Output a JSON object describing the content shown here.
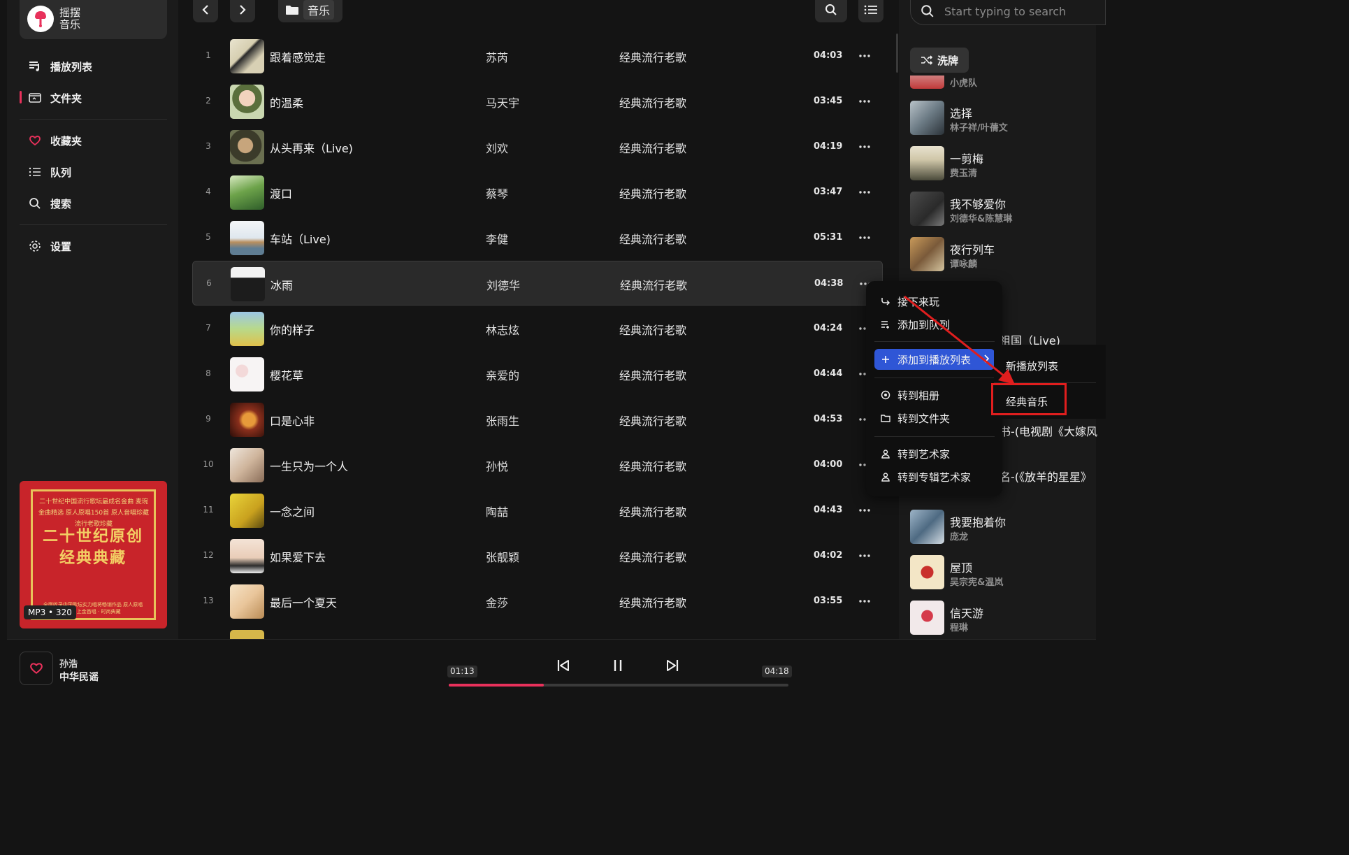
{
  "app": {
    "name": "摇摆音乐"
  },
  "sidebar": {
    "items": [
      {
        "label": "播放列表",
        "icon": "playlist-icon"
      },
      {
        "label": "文件夹",
        "icon": "folder-icon",
        "active": true
      },
      {
        "label": "收藏夹",
        "icon": "heart-icon"
      },
      {
        "label": "队列",
        "icon": "queue-icon"
      },
      {
        "label": "搜索",
        "icon": "search-icon"
      },
      {
        "label": "设置",
        "icon": "gear-icon"
      }
    ],
    "accent_color": "#e8315b",
    "cover": {
      "top_text": "二十世纪中国流行歌坛最成名金曲 麦琬金曲精选 原人原唱150首 原人音唱珍藏 流行老歌珍藏",
      "big_text": "二十世纪原创经典典藏",
      "bottom_text": "全面收录中国歌坛实力唱将畅销作品 原人原唱 百首 上金首唱 · 时尚典藏"
    },
    "quality": "MP3 • 320"
  },
  "topbar": {
    "back": "chevron-left-icon",
    "forward": "chevron-right-icon",
    "breadcrumb_folder": "音乐"
  },
  "songs": [
    {
      "index": "1",
      "title": "跟着感觉走",
      "artist": "苏芮",
      "album": "经典流行老歌",
      "duration": "04:03"
    },
    {
      "index": "2",
      "title": "的温柔",
      "artist": "马天宇",
      "album": "经典流行老歌",
      "duration": "03:45"
    },
    {
      "index": "3",
      "title": "从头再来（Live)",
      "artist": "刘欢",
      "album": "经典流行老歌",
      "duration": "04:19"
    },
    {
      "index": "4",
      "title": "渡口",
      "artist": "蔡琴",
      "album": "经典流行老歌",
      "duration": "03:47"
    },
    {
      "index": "5",
      "title": "车站（Live)",
      "artist": "李健",
      "album": "经典流行老歌",
      "duration": "05:31"
    },
    {
      "index": "6",
      "title": "冰雨",
      "artist": "刘德华",
      "album": "经典流行老歌",
      "duration": "04:38"
    },
    {
      "index": "7",
      "title": "你的样子",
      "artist": "林志炫",
      "album": "经典流行老歌",
      "duration": "04:24"
    },
    {
      "index": "8",
      "title": "樱花草",
      "artist": "亲爱的",
      "album": "经典流行老歌",
      "duration": "04:44"
    },
    {
      "index": "9",
      "title": "口是心非",
      "artist": "张雨生",
      "album": "经典流行老歌",
      "duration": "04:53"
    },
    {
      "index": "10",
      "title": "一生只为一个人",
      "artist": "孙悦",
      "album": "经典流行老歌",
      "duration": "04:00"
    },
    {
      "index": "11",
      "title": "一念之间",
      "artist": "陶喆",
      "album": "经典流行老歌",
      "duration": "04:43"
    },
    {
      "index": "12",
      "title": "如果爱下去",
      "artist": "张靓颖",
      "album": "经典流行老歌",
      "duration": "04:02"
    },
    {
      "index": "13",
      "title": "最后一个夏天",
      "artist": "金莎",
      "album": "经典流行老歌",
      "duration": "03:55"
    }
  ],
  "right_panel": {
    "search_placeholder": "Start typing to search",
    "shuffle_label": "洗牌",
    "partial_top_artist": "小虎队",
    "queue": [
      {
        "title": "选择",
        "artist": "林子祥/叶蒨文"
      },
      {
        "title": "一剪梅",
        "artist": "费玉清"
      },
      {
        "title": "我不够爱你",
        "artist": "刘德华&陈慧琳"
      },
      {
        "title": "夜行列车",
        "artist": "谭咏麟"
      }
    ],
    "partial_live": "祖国（Live)",
    "partial_drama1": "书-(电视剧《大嫁风",
    "partial_drama2": "名-(《放羊的星星》",
    "queue_bottom": [
      {
        "title": "我要抱着你",
        "artist": "庞龙"
      },
      {
        "title": "屋顶",
        "artist": "吴宗宪&温岚"
      },
      {
        "title": "信天游",
        "artist": "程琳"
      }
    ]
  },
  "context_menu": {
    "items": [
      {
        "label": "接下来玩",
        "icon": "play-next-icon"
      },
      {
        "label": "添加到队列",
        "icon": "add-queue-icon"
      },
      {
        "label": "添加到播放列表",
        "icon": "plus-icon",
        "highlighted": true
      },
      {
        "label": "转到相册",
        "icon": "album-icon"
      },
      {
        "label": "转到文件夹",
        "icon": "folder-icon"
      },
      {
        "label": "转到艺术家",
        "icon": "user-icon"
      },
      {
        "label": "转到专辑艺术家",
        "icon": "user-icon"
      }
    ],
    "highlight_color": "#2f56d6",
    "submenu": {
      "new_playlist": "新播放列表",
      "playlist": "经典音乐"
    },
    "annotation_color": "#e01e1e"
  },
  "player": {
    "artist": "孙浩",
    "album": "中华民谣",
    "elapsed": "01:13",
    "total": "04:18",
    "progress": 0.28
  }
}
